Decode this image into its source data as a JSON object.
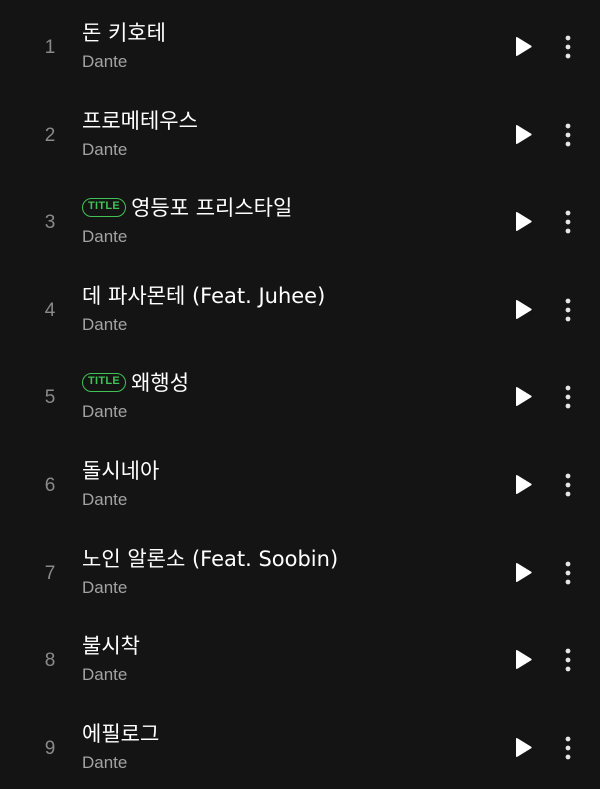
{
  "tracks": [
    {
      "number": "1",
      "title": "돈 키호테",
      "artist": "Dante",
      "badge": ""
    },
    {
      "number": "2",
      "title": "프로메테우스",
      "artist": "Dante",
      "badge": ""
    },
    {
      "number": "3",
      "title": "영등포 프리스타일",
      "artist": "Dante",
      "badge": "TITLE"
    },
    {
      "number": "4",
      "title": "데 파사몬테 (Feat. Juhee)",
      "artist": "Dante",
      "badge": ""
    },
    {
      "number": "5",
      "title": "왜행성",
      "artist": "Dante",
      "badge": "TITLE"
    },
    {
      "number": "6",
      "title": "돌시네아",
      "artist": "Dante",
      "badge": ""
    },
    {
      "number": "7",
      "title": "노인 알론소 (Feat. Soobin)",
      "artist": "Dante",
      "badge": ""
    },
    {
      "number": "8",
      "title": "불시착",
      "artist": "Dante",
      "badge": ""
    },
    {
      "number": "9",
      "title": "에필로그",
      "artist": "Dante",
      "badge": ""
    }
  ],
  "icons": {
    "play": "play-icon",
    "more": "more-vertical-icon"
  },
  "colors": {
    "background": "#141414",
    "title_text": "#ffffff",
    "artist_text": "#a3a3a3",
    "number_text": "#8a8a8a",
    "badge_accent": "#41c254"
  }
}
